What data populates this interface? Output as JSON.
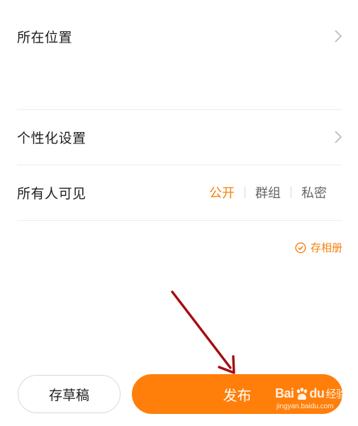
{
  "rows": {
    "location": {
      "label": "所在位置"
    },
    "personalization": {
      "label": "个性化设置"
    },
    "visibility": {
      "label": "所有人可见",
      "options": [
        "公开",
        "群组",
        "私密"
      ],
      "selected": "公开"
    }
  },
  "save_album": {
    "label": "存相册",
    "icon": "check-circle-icon"
  },
  "footer": {
    "draft_label": "存草稿",
    "publish_label": "发布"
  },
  "annotation": {
    "icon": "red-arrow-icon",
    "color": "#a50d12"
  },
  "watermark": {
    "brand_prefix": "Bai",
    "brand_suffix": "du",
    "brand_product": "经验",
    "url": "jingyan.baidu.com"
  },
  "colors": {
    "accent": "#f77f0f",
    "publish_bg": "#ff7f0a",
    "divider": "#ececec"
  }
}
